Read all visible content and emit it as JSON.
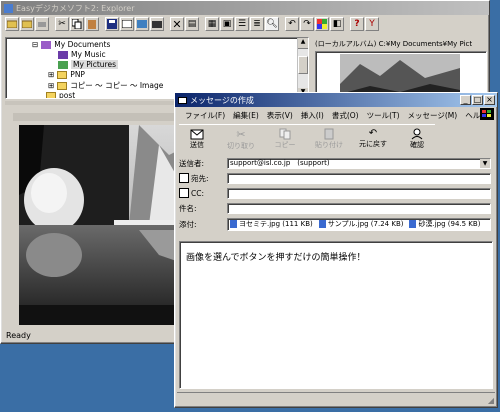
{
  "explorer": {
    "title": "Easyデジカメソフト2: Explorer",
    "tree": [
      {
        "label": "My Documents",
        "expander": "⊟"
      },
      {
        "label": "My Music",
        "expander": ""
      },
      {
        "label": "My Pictures",
        "expander": ""
      },
      {
        "label": "PNP",
        "expander": "⊞"
      },
      {
        "label": "コピー ～ コピー ～ Image",
        "expander": "⊞"
      },
      {
        "label": "post",
        "expander": ""
      }
    ],
    "path": "(ローカルアルバム) C:¥My Documents¥My Pict",
    "status": "Ready"
  },
  "compose": {
    "title": "メッセージの作成",
    "menu": [
      "ファイル(F)",
      "編集(E)",
      "表示(V)",
      "挿入(I)",
      "書式(O)",
      "ツール(T)",
      "メッセージ(M)",
      "ヘル"
    ],
    "toolbar": [
      {
        "label": "送信",
        "icon": "send-icon",
        "enabled": true
      },
      {
        "label": "切り取り",
        "icon": "cut-icon",
        "enabled": false
      },
      {
        "label": "コピー",
        "icon": "copy-icon",
        "enabled": false
      },
      {
        "label": "貼り付け",
        "icon": "paste-icon",
        "enabled": false
      },
      {
        "label": "元に戻す",
        "icon": "undo-icon",
        "enabled": true
      },
      {
        "label": "確認",
        "icon": "check-names-icon",
        "enabled": true
      }
    ],
    "from_label": "送信者:",
    "from_value": "support@isl.co.jp　(support)",
    "to_label": "宛先:",
    "cc_label": "CC:",
    "subject_label": "件名:",
    "attach_label": "添付:",
    "attachments": [
      "ヨセミテ.jpg (111 KB)",
      "サンプル.jpg (7.24 KB)",
      "砂漠.jpg (94.5 KB)"
    ],
    "body": "画像を選んでボタンを押すだけの簡単操作！"
  }
}
